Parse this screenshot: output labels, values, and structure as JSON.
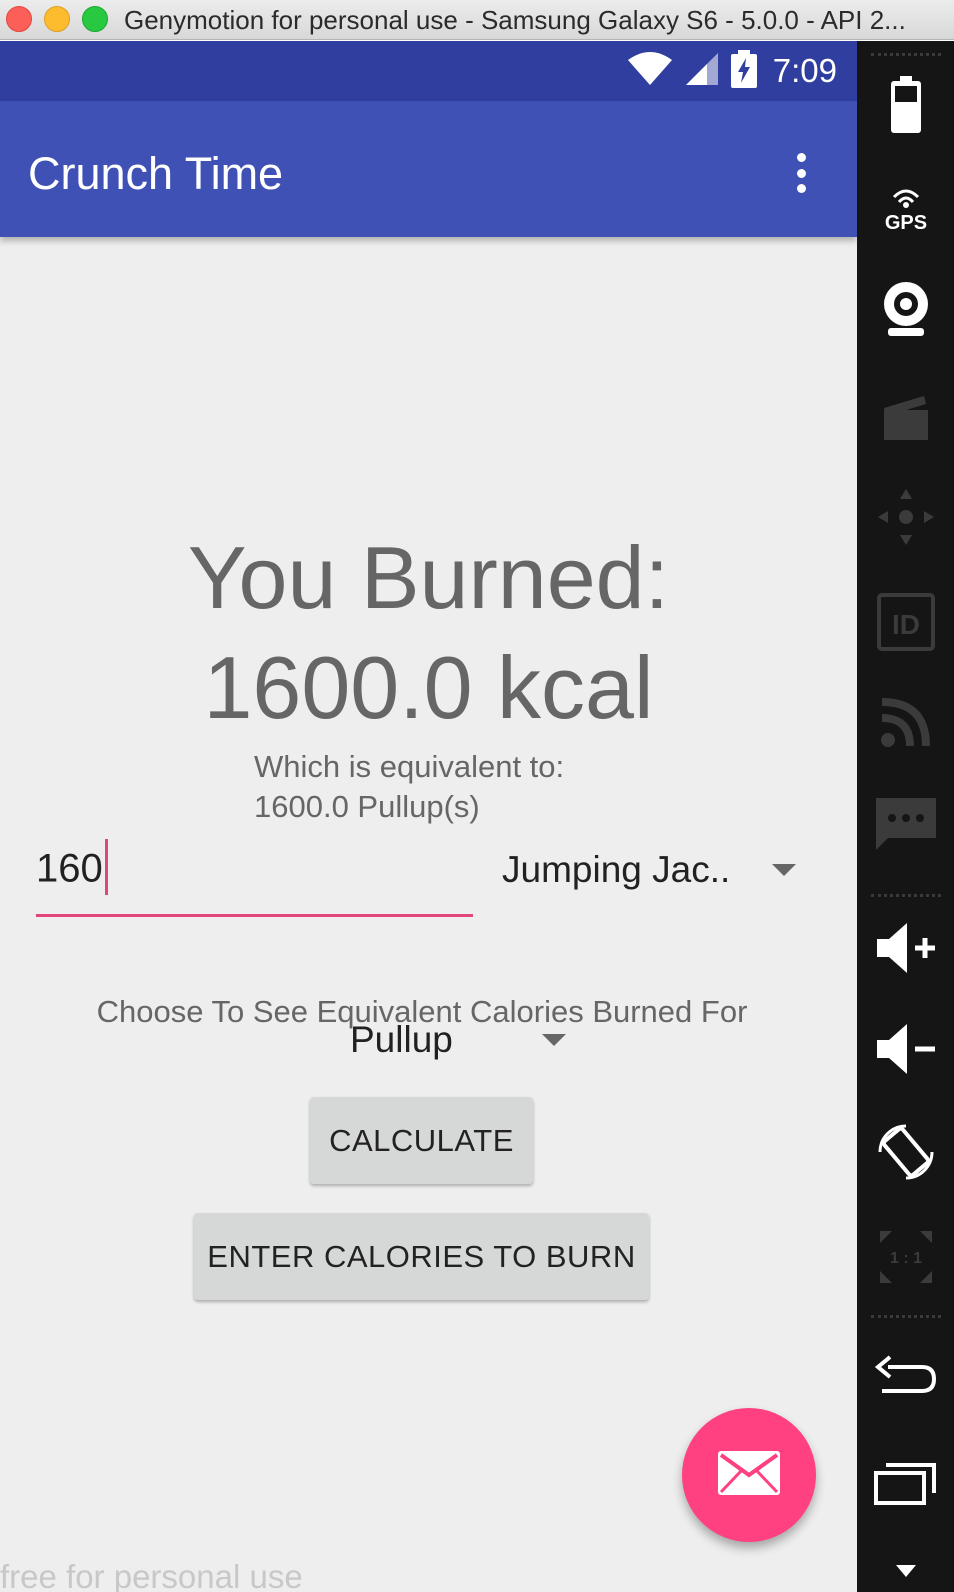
{
  "window": {
    "title": "Genymotion for personal use - Samsung Galaxy S6 - 5.0.0 - API 2..."
  },
  "status_bar": {
    "time": "7:09",
    "icons": [
      "wifi-icon",
      "cell-signal-icon",
      "battery-charging-icon"
    ]
  },
  "app_bar": {
    "title": "Crunch Time",
    "menu_icon": "more-vert-icon"
  },
  "result": {
    "line1": "You Burned:",
    "line2": "1600.0 kcal",
    "equivalent_label": "Which is equivalent to:",
    "equivalent_value": "1600.0 Pullup(s)"
  },
  "form": {
    "amount_value": "160",
    "exercise_selected": "Jumping Jac..",
    "choose_label": "Choose To See Equivalent Calories Burned For",
    "equivalent_exercise_selected": "Pullup",
    "calculate_label": "CALCULATE",
    "enter_calories_label": "ENTER CALORIES TO BURN"
  },
  "fab": {
    "icon": "email-icon"
  },
  "watermark": "free for personal use",
  "sidebar": {
    "icons": [
      "battery-icon",
      "gps-icon",
      "webcam-icon",
      "clapperboard-icon",
      "dpad-icon",
      "id-icon",
      "rss-icon",
      "chat-icon",
      "volume-up-icon",
      "volume-down-icon",
      "rotate-icon",
      "scale-icon",
      "back-icon",
      "recent-apps-icon"
    ]
  },
  "colors": {
    "status_bar": "#303f9f",
    "app_bar": "#3f51b5",
    "accent": "#ff4081",
    "background": "#eeeeee",
    "text_secondary": "#666666",
    "button": "#d6d7d7"
  }
}
